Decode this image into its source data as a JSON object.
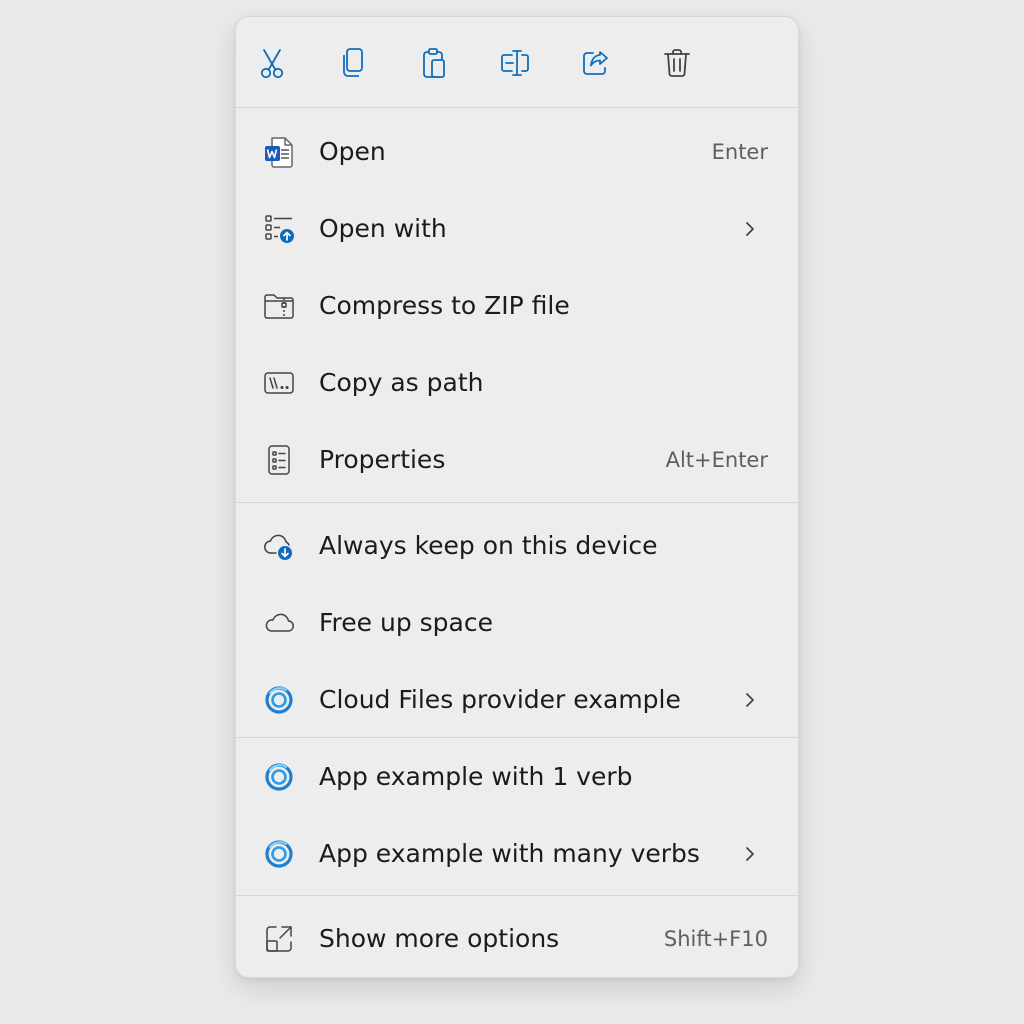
{
  "toolbar": {
    "buttons": [
      {
        "icon": "cut-icon"
      },
      {
        "icon": "copy-icon"
      },
      {
        "icon": "paste-icon"
      },
      {
        "icon": "rename-icon"
      },
      {
        "icon": "share-icon"
      },
      {
        "icon": "delete-icon"
      }
    ]
  },
  "menu": {
    "open": {
      "label": "Open",
      "accel": "Enter",
      "icon": "word-document-icon"
    },
    "open_with": {
      "label": "Open with",
      "icon": "open-with-icon"
    },
    "compress": {
      "label": "Compress to ZIP file",
      "icon": "zip-folder-icon"
    },
    "copy_path": {
      "label": "Copy as path",
      "icon": "copy-path-icon"
    },
    "properties": {
      "label": "Properties",
      "accel": "Alt+Enter",
      "icon": "properties-icon"
    },
    "always_keep": {
      "label": "Always keep on this device",
      "icon": "cloud-download-icon"
    },
    "free_space": {
      "label": "Free up space",
      "icon": "cloud-icon"
    },
    "cloud_provider": {
      "label": "Cloud Files provider example",
      "icon": "app-ring-icon"
    },
    "app_one_verb": {
      "label": "App example with 1 verb",
      "icon": "app-ring-icon"
    },
    "app_many_verbs": {
      "label": "App example with many verbs",
      "icon": "app-ring-icon"
    },
    "show_more": {
      "label": "Show more options",
      "accel": "Shift+F10",
      "icon": "show-more-icon"
    }
  },
  "colors": {
    "accent": "#0f6cbd",
    "icon_stroke": "#444444",
    "menu_background": "#ededed",
    "page_background": "#eaeaea"
  }
}
